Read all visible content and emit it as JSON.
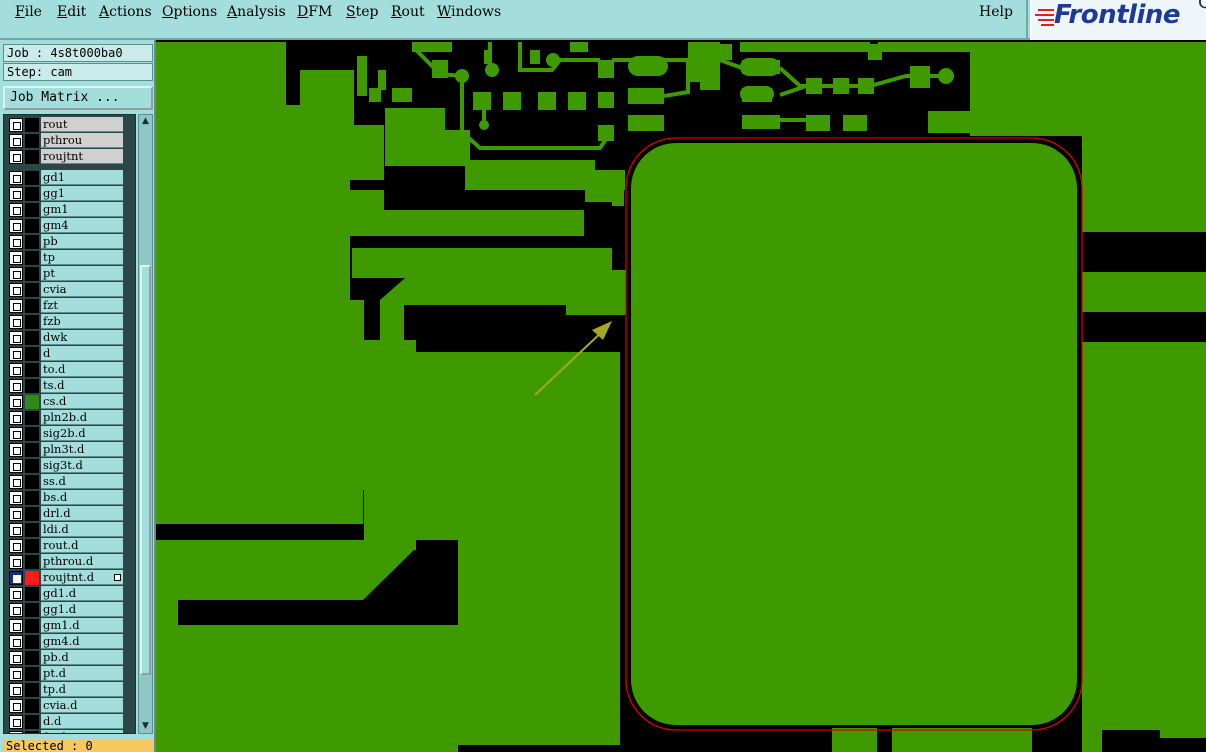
{
  "menu": {
    "items": [
      "File",
      "Edit",
      "Actions",
      "Options",
      "Analysis",
      "DFM",
      "Step",
      "Rout",
      "Windows"
    ],
    "help": "Help"
  },
  "logo": {
    "text": "Frontline",
    "corner": "C"
  },
  "job": {
    "label": "Job : 4s8t000ba0",
    "step": "Step: cam"
  },
  "job_matrix_button": "Job Matrix ...",
  "layers": [
    {
      "name": "rout",
      "style": "grey"
    },
    {
      "name": "pthrou",
      "style": "grey"
    },
    {
      "name": "roujtnt",
      "style": "grey"
    },
    {
      "name": "gd1"
    },
    {
      "name": "gg1"
    },
    {
      "name": "gm1"
    },
    {
      "name": "gm4"
    },
    {
      "name": "pb"
    },
    {
      "name": "tp"
    },
    {
      "name": "pt"
    },
    {
      "name": "cvia"
    },
    {
      "name": "fzt"
    },
    {
      "name": "fzb"
    },
    {
      "name": "dwk"
    },
    {
      "name": "d"
    },
    {
      "name": "to.d"
    },
    {
      "name": "ts.d"
    },
    {
      "name": "cs.d",
      "swatch": "#2e8b1a"
    },
    {
      "name": "pln2b.d"
    },
    {
      "name": "sig2b.d"
    },
    {
      "name": "pln3t.d"
    },
    {
      "name": "sig3t.d"
    },
    {
      "name": "ss.d"
    },
    {
      "name": "bs.d"
    },
    {
      "name": "drl.d"
    },
    {
      "name": "ldi.d"
    },
    {
      "name": "rout.d"
    },
    {
      "name": "pthrou.d"
    },
    {
      "name": "roujtnt.d",
      "swatch": "#ff1a1a",
      "selected": true
    },
    {
      "name": "gd1.d"
    },
    {
      "name": "gg1.d"
    },
    {
      "name": "gm1.d"
    },
    {
      "name": "gm4.d"
    },
    {
      "name": "pb.d"
    },
    {
      "name": "pt.d"
    },
    {
      "name": "tp.d"
    },
    {
      "name": "cvia.d"
    },
    {
      "name": "d.d"
    },
    {
      "name": "f.t.d"
    }
  ],
  "status": {
    "selected": "Selected : 0"
  },
  "colors": {
    "copper": "#3f9a00",
    "background": "#000000",
    "outline": "#d40000",
    "arrow": "#a8a820",
    "panel": "#a3dedc"
  },
  "icons": [
    "checkbox-icon",
    "scroll-up-icon",
    "scroll-down-icon",
    "frontline-logo-mark"
  ]
}
